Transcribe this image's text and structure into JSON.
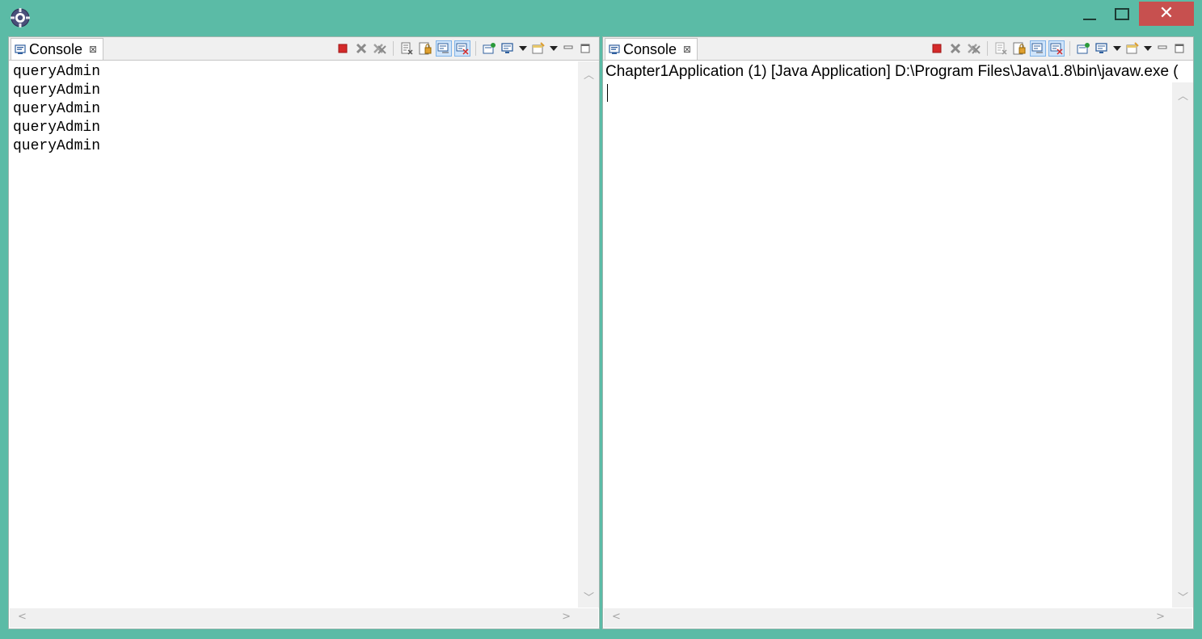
{
  "window": {
    "app_icon": "eclipse-gear-icon",
    "controls": {
      "minimize": "minimize-icon",
      "maximize": "maximize-icon",
      "close": "close-icon",
      "close_glyph": "✕"
    }
  },
  "colors": {
    "frame": "#5bbba6",
    "close_button": "#c7504f",
    "terminate": "#d42a2a",
    "toggle_pressed": "#cfe4fa"
  },
  "left_pane": {
    "tab": {
      "label": "Console",
      "close_glyph": "⊠"
    },
    "lines": [
      "queryAdmin",
      "queryAdmin",
      "queryAdmin",
      "queryAdmin",
      "queryAdmin"
    ]
  },
  "right_pane": {
    "tab": {
      "label": "Console",
      "close_glyph": "⊠"
    },
    "process_label": "Chapter1Application (1) [Java Application] D:\\Program Files\\Java\\1.8\\bin\\javaw.exe ("
  },
  "toolbar_icons": [
    "terminate-icon",
    "remove-launch-icon",
    "remove-all-terminated-icon",
    "clear-console-icon",
    "scroll-lock-icon",
    "word-wrap-icon",
    "show-on-stdout-icon",
    "pin-console-icon",
    "display-console-icon",
    "open-console-icon",
    "minimize-view-icon",
    "maximize-view-icon"
  ],
  "scroll_glyphs": {
    "up": "︿",
    "down": "﹀",
    "left": "<",
    "right": ">"
  }
}
